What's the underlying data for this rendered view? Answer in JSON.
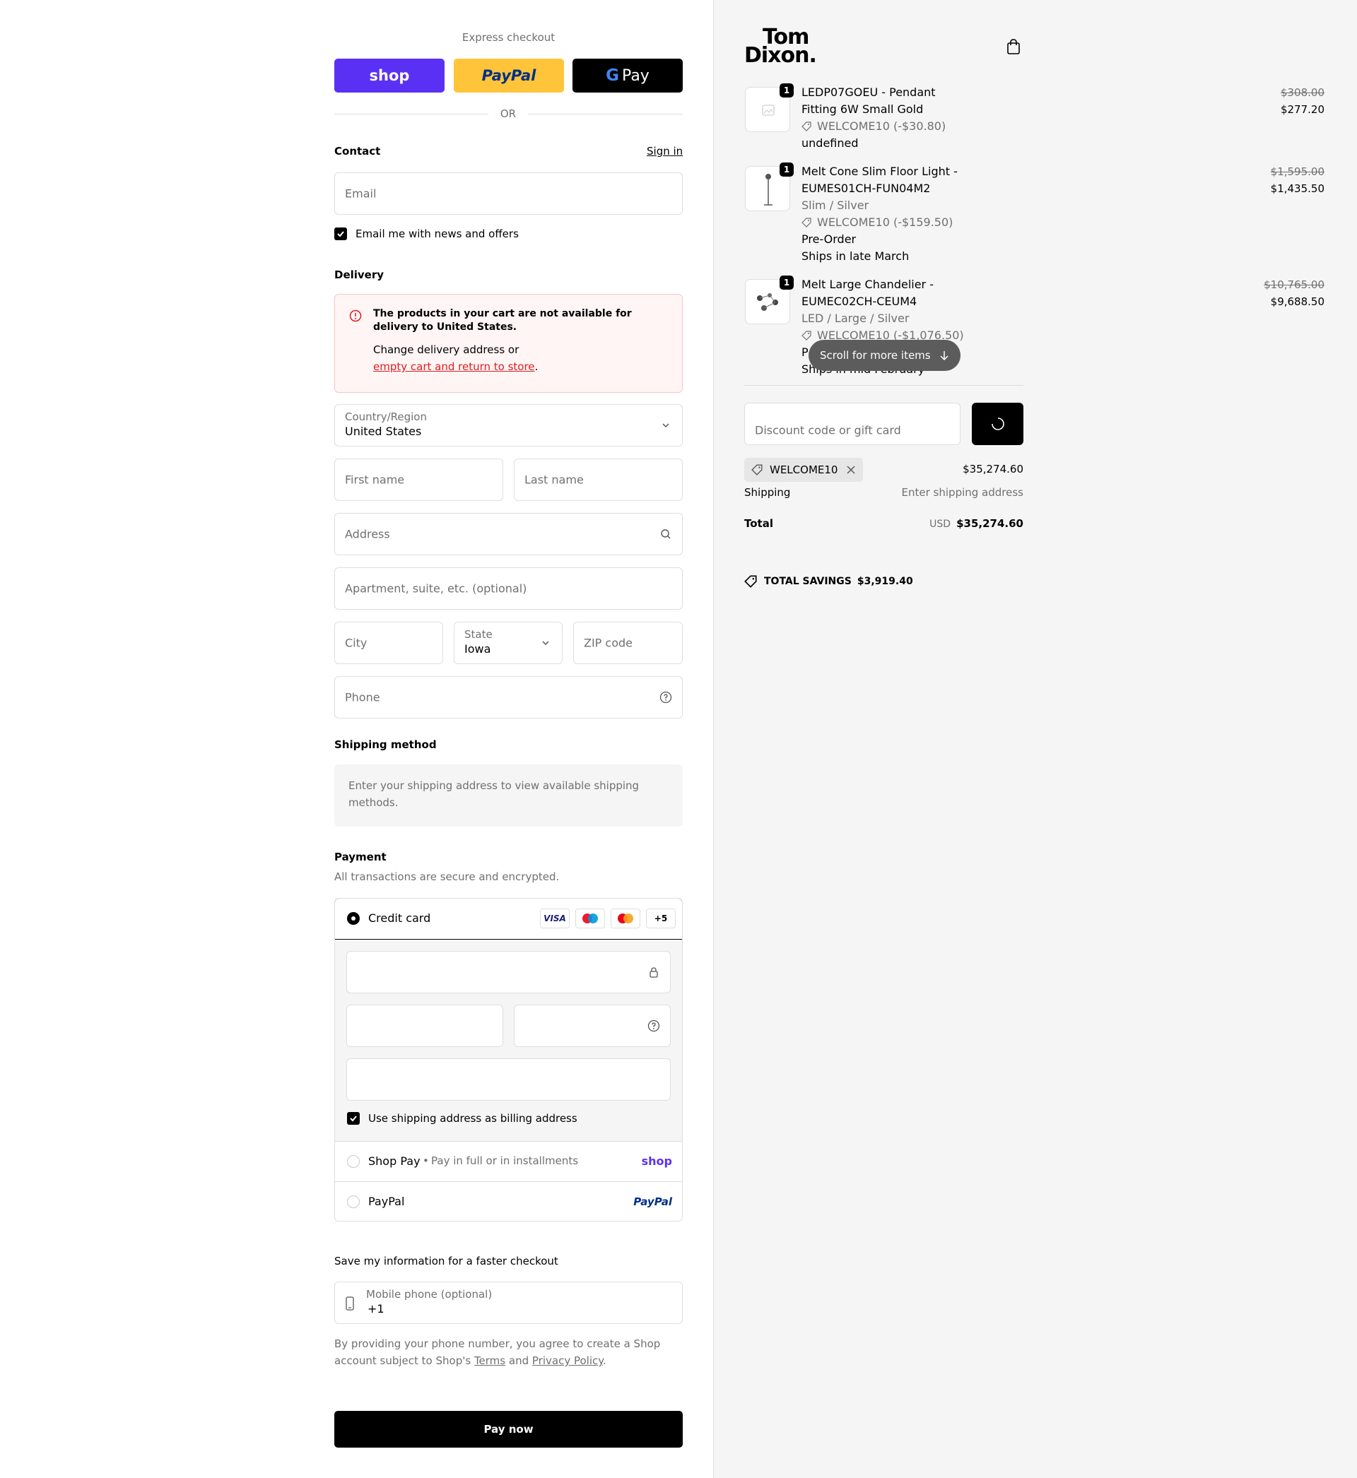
{
  "express": {
    "title": "Express checkout",
    "shop_label": "shop",
    "paypal_label": "PayPal",
    "gpay_label": "Pay",
    "or_label": "OR"
  },
  "contact": {
    "title": "Contact",
    "sign_in": "Sign in",
    "email_placeholder": "Email",
    "news_label": "Email me with news and offers"
  },
  "delivery": {
    "title": "Delivery",
    "error_title": "The products in your cart are not available for delivery to United States.",
    "error_body": "Change delivery address or",
    "error_link": "empty cart and return to store",
    "error_tail": ".",
    "country_label": "Country/Region",
    "country_value": "United States",
    "first_name": "First name",
    "last_name": "Last name",
    "address": "Address",
    "apartment": "Apartment, suite, etc. (optional)",
    "city": "City",
    "state_label": "State",
    "state_value": "Iowa",
    "zip": "ZIP code",
    "phone": "Phone"
  },
  "shipping_method": {
    "title": "Shipping method",
    "message": "Enter your shipping address to view available shipping methods."
  },
  "payment": {
    "title": "Payment",
    "subtitle": "All transactions are secure and encrypted.",
    "credit_card": "Credit card",
    "card_more": "+5",
    "visa": "VISA",
    "billing_label": "Use shipping address as billing address",
    "shop_pay": "Shop Pay",
    "shop_pay_sub": "Pay in full or in installments",
    "shop_logo": "shop",
    "paypal": "PayPal",
    "paypal_logo": "PayPal"
  },
  "save_info": {
    "title": "Save my information for a faster checkout",
    "mobile_label": "Mobile phone (optional)",
    "mobile_value": "+1",
    "disclaimer_a": "By providing your phone number, you agree to create a Shop account subject to Shop's ",
    "terms": "Terms",
    "and": " and ",
    "privacy": "Privacy Policy",
    "period": "."
  },
  "pay_now": "Pay now",
  "brand": {
    "line1": "Tom",
    "line2": "Dixon."
  },
  "cart": {
    "items": [
      {
        "qty": "1",
        "name": "LEDP07GOEU - Pendant Fitting 6W Small Gold",
        "discount": "WELCOME10 (-$30.80)",
        "extra": "undefined",
        "old_price": "$308.00",
        "price": "$277.20"
      },
      {
        "qty": "1",
        "name": "Melt Cone Slim Floor Light - EUMES01CH-FUN04M2",
        "variant": "Slim / Silver",
        "discount": "WELCOME10 (-$159.50)",
        "extra": "Pre-Order",
        "extra2": "Ships in late March",
        "old_price": "$1,595.00",
        "price": "$1,435.50"
      },
      {
        "qty": "1",
        "name": "Melt Large Chandelier - EUMEC02CH-CEUM4",
        "variant": "LED / Large / Silver",
        "discount": "WELCOME10 (-$1,076.50)",
        "extra": "P",
        "extra2": "Ships in mid February",
        "old_price": "$10,765.00",
        "price": "$9,688.50"
      }
    ],
    "scroll_hint": "Scroll for more items",
    "discount_placeholder": "Discount code or gift card",
    "applied_code": "WELCOME10",
    "subtotal": "$35,274.60",
    "shipping_label": "Shipping",
    "shipping_value": "Enter shipping address",
    "total_label": "Total",
    "currency": "USD",
    "total": "$35,274.60",
    "savings_label": "TOTAL SAVINGS",
    "savings_value": "$3,919.40"
  },
  "colors": {
    "shop_purple": "#5a31f4",
    "paypal_yellow": "#ffc439",
    "error_red": "#dd1d1d",
    "error_bg": "#fff5f5"
  }
}
